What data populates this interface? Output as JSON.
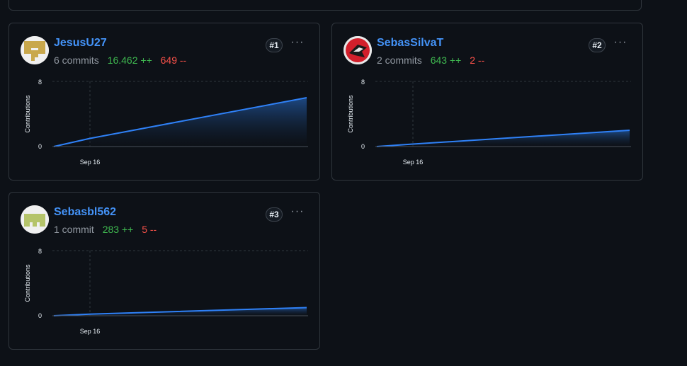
{
  "contributors": [
    {
      "username": "JesusU27",
      "commits": "6 commits",
      "additions": "16.462 ++",
      "deletions": "649 --",
      "rank": "#1",
      "avatar_colors": {
        "bg": "#f0f0f0",
        "fg": "#c9a84c"
      }
    },
    {
      "username": "SebasSilvaT",
      "commits": "2 commits",
      "additions": "643 ++",
      "deletions": "2 --",
      "rank": "#2",
      "avatar_colors": {
        "bg": "#e8e8e8",
        "fg": "#d21f2b"
      }
    },
    {
      "username": "Sebasbl562",
      "commits": "1 commit",
      "additions": "283 ++",
      "deletions": "5 --",
      "rank": "#3",
      "avatar_colors": {
        "bg": "#f0f0f0",
        "fg": "#b5c46a"
      }
    }
  ],
  "more_label": "···",
  "chart_data": [
    {
      "type": "area",
      "ylabel": "Contributions",
      "ylim": [
        0,
        8
      ],
      "yticks": [
        "0",
        "8"
      ],
      "xticks": [
        "Sep 16"
      ],
      "series": [
        {
          "values": [
            0,
            1,
            6
          ]
        }
      ],
      "color": "#2f81f7"
    },
    {
      "type": "area",
      "ylabel": "Contributions",
      "ylim": [
        0,
        8
      ],
      "yticks": [
        "0",
        "8"
      ],
      "xticks": [
        "Sep 16"
      ],
      "series": [
        {
          "values": [
            0,
            0.3,
            2
          ]
        }
      ],
      "color": "#2f81f7"
    },
    {
      "type": "area",
      "ylabel": "Contributions",
      "ylim": [
        0,
        8
      ],
      "yticks": [
        "0",
        "8"
      ],
      "xticks": [
        "Sep 16"
      ],
      "series": [
        {
          "values": [
            0,
            0.2,
            1
          ]
        }
      ],
      "color": "#2f81f7"
    }
  ]
}
